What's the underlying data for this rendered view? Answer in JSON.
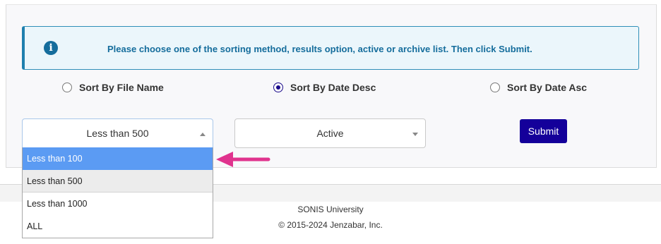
{
  "alert": {
    "icon": "info-circle-icon",
    "message": "Please choose one of the sorting method, results option, active or archive list. Then click Submit."
  },
  "sort_options": [
    {
      "label": "Sort By File Name",
      "checked": false
    },
    {
      "label": "Sort By Date Desc",
      "checked": true
    },
    {
      "label": "Sort By Date Asc",
      "checked": false
    }
  ],
  "results_select": {
    "value": "Less than 500",
    "options": [
      "Less than 100",
      "Less than 500",
      "Less than 1000",
      "ALL"
    ],
    "highlighted": "Less than 100"
  },
  "status_select": {
    "value": "Active"
  },
  "submit_label": "Submit",
  "footer": {
    "line1": "SONIS University",
    "line2": "© 2015-2024 Jenzabar, Inc."
  },
  "colors": {
    "alert_text": "#156d9c",
    "submit_bg": "#14009a",
    "highlight": "#5b9bf3",
    "arrow": "#e0338e"
  }
}
